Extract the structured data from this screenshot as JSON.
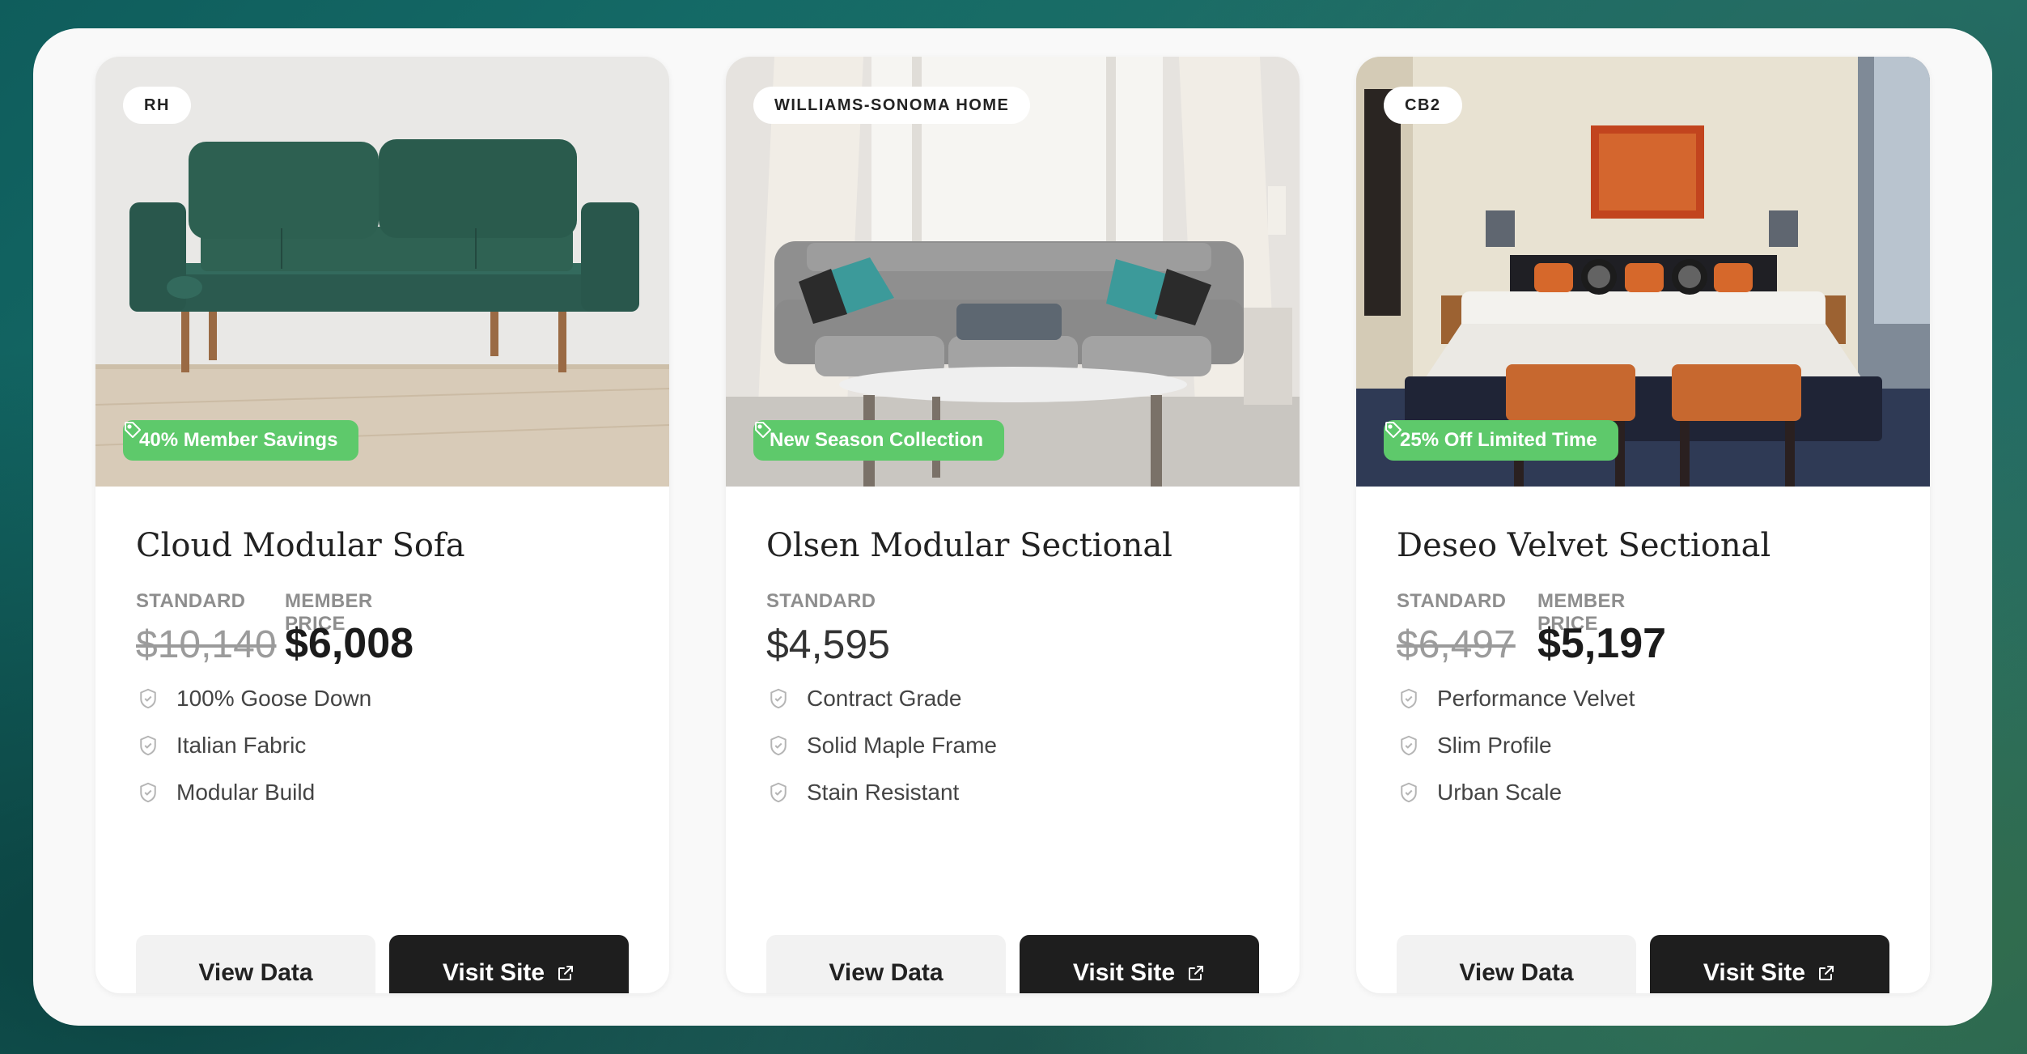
{
  "colors": {
    "promo_green": "#5ec96b",
    "button_dark": "#1e1e1e",
    "button_light": "#f2f2f2"
  },
  "icons": {
    "promo": "tag-icon",
    "feature": "shield-check-icon",
    "visit": "external-link-icon"
  },
  "cards": [
    {
      "brand": "RH",
      "promo": "40% Member Savings",
      "title": "Cloud Modular Sofa",
      "standard_label": "STANDARD",
      "member_label": "MEMBER PRICE",
      "standard_price": "$10,140",
      "member_price": "$6,008",
      "features": [
        "100% Goose Down",
        "Italian Fabric",
        "Modular Build"
      ],
      "view_label": "View Data",
      "visit_label": "Visit Site"
    },
    {
      "brand": "WILLIAMS-SONOMA HOME",
      "promo": "New Season Collection",
      "title": "Olsen Modular Sectional",
      "standard_label": "STANDARD",
      "price": "$4,595",
      "features": [
        "Contract Grade",
        "Solid Maple Frame",
        "Stain Resistant"
      ],
      "view_label": "View Data",
      "visit_label": "Visit Site"
    },
    {
      "brand": "CB2",
      "promo": "25% Off Limited Time",
      "title": "Deseo Velvet Sectional",
      "standard_label": "STANDARD",
      "member_label": "MEMBER PRICE",
      "standard_price": "$6,497",
      "member_price": "$5,197",
      "features": [
        "Performance Velvet",
        "Slim Profile",
        "Urban Scale"
      ],
      "view_label": "View Data",
      "visit_label": "Visit Site"
    }
  ]
}
